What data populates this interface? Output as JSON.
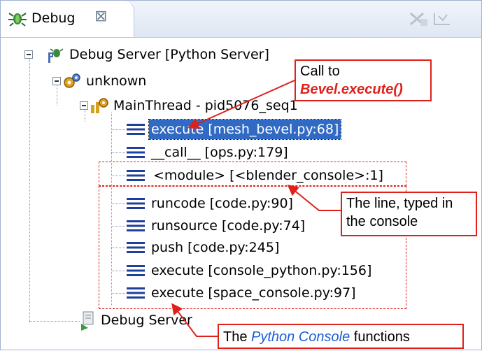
{
  "view": {
    "tab_title": "Debug",
    "tab_close": "⊠"
  },
  "tree": {
    "server_label": "Debug Server [Python Server]",
    "group_label": "unknown",
    "thread_label": "MainThread - pid5076_seq1",
    "frames": [
      "execute [mesh_bevel.py:68]",
      "__call__ [ops.py:179]",
      "<module> [<blender_console>:1]",
      "runcode [code.py:90]",
      "runsource [code.py:74]",
      "push [code.py:245]",
      "execute [console_python.py:156]",
      "execute [space_console.py:97]"
    ],
    "launcher_label": "Debug Server"
  },
  "annotations": {
    "call_to_line1": "Call to",
    "call_to_line2": "Bevel.execute()",
    "typed_line_1": "The line, typed in",
    "typed_line_2": "the console",
    "console_pre": "The ",
    "console_em": "Python Console",
    "console_post": " functions"
  },
  "colors": {
    "selection": "#316ac5",
    "annotation_red": "#e0201a",
    "console_blue": "#1a5fd6"
  }
}
